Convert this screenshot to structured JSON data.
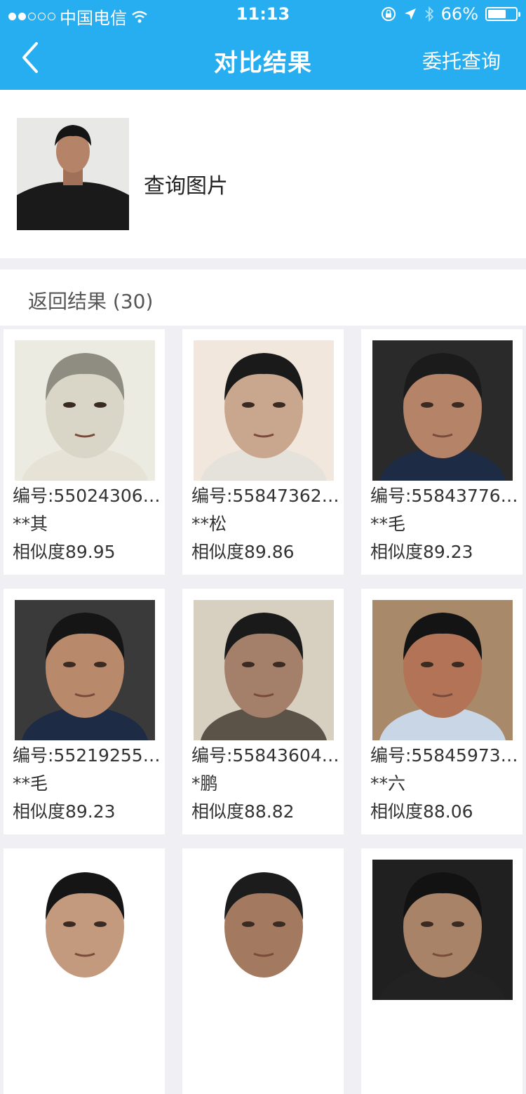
{
  "status_bar": {
    "carrier": "中国电信",
    "time": "11:13",
    "battery": "66%",
    "battery_level": 0.66
  },
  "nav": {
    "title": "对比结果",
    "action_label": "委托查询"
  },
  "query": {
    "label": "查询图片"
  },
  "results": {
    "title": "返回结果",
    "count": "(30)",
    "items": [
      {
        "id": "编号:55024306…",
        "name": "**其",
        "similarity": "相似度89.95"
      },
      {
        "id": "编号:55847362…",
        "name": "**松",
        "similarity": "相似度89.86"
      },
      {
        "id": "编号:55843776…",
        "name": "**毛",
        "similarity": "相似度89.23"
      },
      {
        "id": "编号:55219255…",
        "name": "**毛",
        "similarity": "相似度89.23"
      },
      {
        "id": "编号:55843604…",
        "name": "*鹏",
        "similarity": "相似度88.82"
      },
      {
        "id": "编号:55845973…",
        "name": "**六",
        "similarity": "相似度88.06"
      },
      {
        "id": "",
        "name": "",
        "similarity": ""
      },
      {
        "id": "",
        "name": "",
        "similarity": ""
      },
      {
        "id": "",
        "name": "",
        "similarity": ""
      }
    ]
  },
  "colors": {
    "header": "#27aef0",
    "page_bg": "#f0eff4"
  }
}
